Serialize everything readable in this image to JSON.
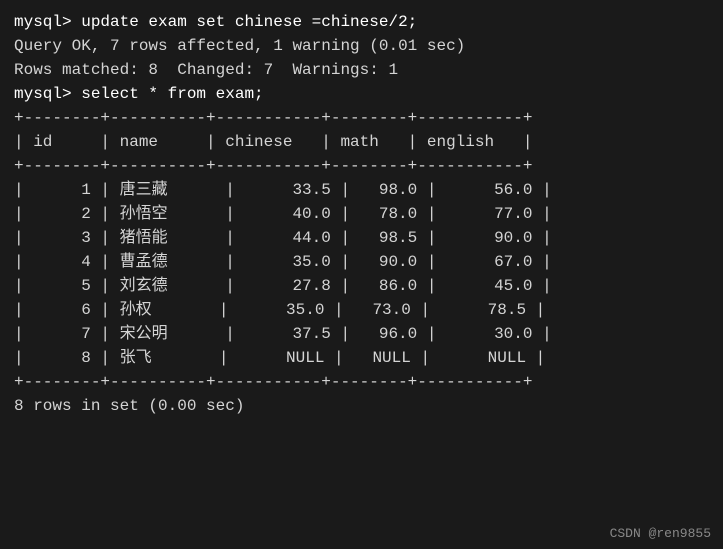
{
  "terminal": {
    "lines": [
      {
        "type": "prompt",
        "text": "mysql> update exam set chinese =chinese/2;"
      },
      {
        "type": "output",
        "text": "Query OK, 7 rows affected, 1 warning (0.01 sec)"
      },
      {
        "type": "output",
        "text": "Rows matched: 8  Changed: 7  Warnings: 1"
      },
      {
        "type": "blank",
        "text": ""
      },
      {
        "type": "prompt",
        "text": "mysql> select * from exam;"
      }
    ],
    "table_border": "+--------+----------+-----------+--------+-----------+",
    "table_header": "| id     | name     | chinese   | math   | english   |",
    "rows": [
      {
        "id": "1",
        "name": "唐三藏",
        "chinese": "33.5",
        "math": "98.0",
        "english": "56.0"
      },
      {
        "id": "2",
        "name": "孙悟空",
        "chinese": "40.0",
        "math": "78.0",
        "english": "77.0"
      },
      {
        "id": "3",
        "name": "猪悟能",
        "chinese": "44.0",
        "math": "98.5",
        "english": "90.0"
      },
      {
        "id": "4",
        "name": "曹孟德",
        "chinese": "35.0",
        "math": "90.0",
        "english": "67.0"
      },
      {
        "id": "5",
        "name": "刘玄德",
        "chinese": "27.8",
        "math": "86.0",
        "english": "45.0"
      },
      {
        "id": "6",
        "name": "孙权",
        "chinese": "35.0",
        "math": "73.0",
        "english": "78.5"
      },
      {
        "id": "7",
        "name": "宋公明",
        "chinese": "37.5",
        "math": "96.0",
        "english": "30.0"
      },
      {
        "id": "8",
        "name": "张飞",
        "chinese": "NULL",
        "math": "NULL",
        "english": "NULL"
      }
    ],
    "footer": "8 rows in set (0.00 sec)"
  },
  "watermark": "CSDN @ren9855"
}
